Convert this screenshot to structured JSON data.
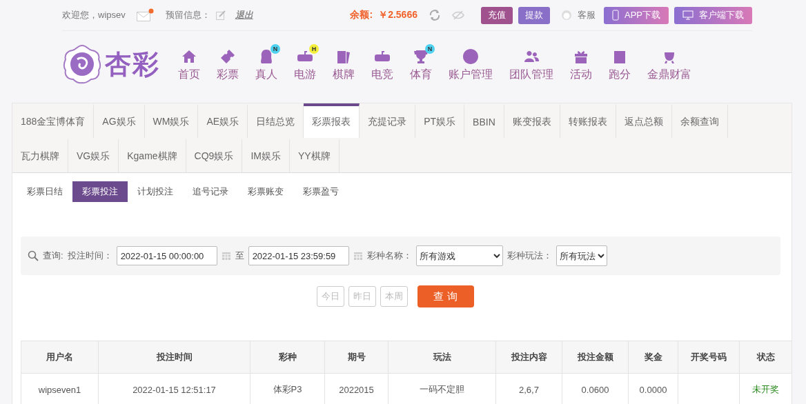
{
  "top_bar": {
    "welcome": "欢迎您，wipsev",
    "mail_unread": true,
    "reserved_label": "预留信息：",
    "logout": "退出",
    "balance_label": "余额:",
    "balance": "￥2.5666",
    "deposit": "充值",
    "withdraw": "提款",
    "service": "客服",
    "app_download": "APP下载",
    "client_download": "客户端下载"
  },
  "logo": {
    "text": "杏彩"
  },
  "nav": [
    {
      "label": "首页"
    },
    {
      "label": "彩票"
    },
    {
      "label": "真人",
      "badge": {
        "text": "N",
        "color": "#4fd2ef"
      }
    },
    {
      "label": "电游",
      "badge": {
        "text": "H",
        "color": "#f4ef3c"
      }
    },
    {
      "label": "棋牌"
    },
    {
      "label": "电竞"
    },
    {
      "label": "体育",
      "badge": {
        "text": "N",
        "color": "#4fd2ef"
      }
    },
    {
      "label": "账户管理"
    },
    {
      "label": "团队管理"
    },
    {
      "label": "活动"
    },
    {
      "label": "跑分"
    },
    {
      "label": "金鼎财富"
    }
  ],
  "tab_rows": [
    {
      "tabs": [
        {
          "label": "188金宝博体育",
          "selected": false
        },
        {
          "label": "AG娱乐",
          "selected": false
        },
        {
          "label": "WM娱乐",
          "selected": false
        },
        {
          "label": "AE娱乐",
          "selected": false
        },
        {
          "label": "日结总览",
          "selected": false
        },
        {
          "label": "彩票报表",
          "selected": true
        },
        {
          "label": "充提记录",
          "selected": false
        },
        {
          "label": "PT娱乐",
          "selected": false
        },
        {
          "label": "BBIN",
          "selected": false
        },
        {
          "label": "账变报表",
          "selected": false
        },
        {
          "label": "转账报表",
          "selected": false
        },
        {
          "label": "返点总额",
          "selected": false
        },
        {
          "label": "余额查询",
          "selected": false
        }
      ]
    },
    {
      "tabs": [
        {
          "label": "瓦力棋牌",
          "selected": false
        },
        {
          "label": "VG娱乐",
          "selected": false
        },
        {
          "label": "Kgame棋牌",
          "selected": false
        },
        {
          "label": "CQ9娱乐",
          "selected": false
        },
        {
          "label": "IM娱乐",
          "selected": false
        },
        {
          "label": "YY棋牌",
          "selected": false
        }
      ]
    }
  ],
  "sub_tabs": [
    {
      "label": "彩票日结",
      "selected": false
    },
    {
      "label": "彩票投注",
      "selected": true
    },
    {
      "label": "计划投注",
      "selected": false
    },
    {
      "label": "追号记录",
      "selected": false
    },
    {
      "label": "彩票账变",
      "selected": false
    },
    {
      "label": "彩票盈亏",
      "selected": false
    }
  ],
  "query": {
    "label": "查询:",
    "time_label": "投注时间：",
    "start": "2022-01-15 00:00:00",
    "to": "至",
    "end": "2022-01-15 23:59:59",
    "game_label": "彩种名称：",
    "game": "所有游戏",
    "play_label": "彩种玩法：",
    "play": "所有玩法",
    "quick": [
      "今日",
      "昨日",
      "本周"
    ],
    "submit": "查 询"
  },
  "table": {
    "columns": [
      "用户名",
      "投注时间",
      "彩种",
      "期号",
      "玩法",
      "投注内容",
      "投注金额",
      "奖金",
      "开奖号码",
      "状态"
    ],
    "rows": [
      [
        "wipseven1",
        "2022-01-15 12:51:17",
        "体彩P3",
        "2022015",
        "一码不定胆",
        "2,6,7",
        "0.0600",
        "0.0000",
        "",
        "未开奖"
      ]
    ]
  }
}
